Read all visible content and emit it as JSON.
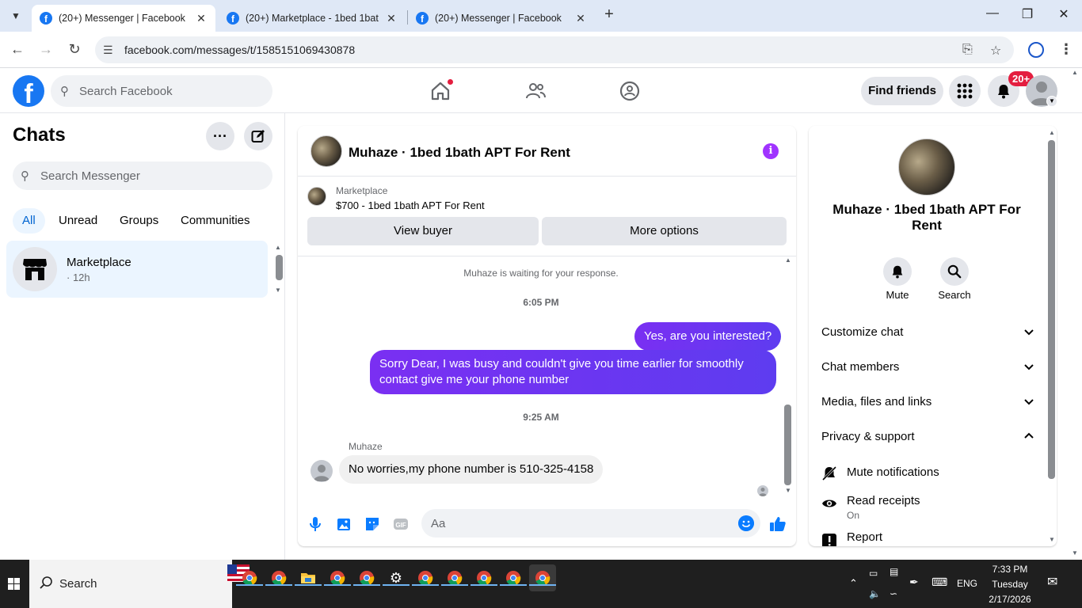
{
  "browser": {
    "tabs": [
      {
        "title": "(20+) Messenger | Facebook",
        "active": true
      },
      {
        "title": "(20+) Marketplace - 1bed 1bat",
        "active": false
      },
      {
        "title": "(20+) Messenger | Facebook",
        "active": false
      }
    ],
    "url": "facebook.com/messages/t/1585151069430878"
  },
  "fb_header": {
    "search_placeholder": "Search Facebook",
    "find_friends": "Find friends",
    "notif_count": "20+"
  },
  "chats": {
    "title": "Chats",
    "search_placeholder": "Search Messenger",
    "filters": [
      "All",
      "Unread",
      "Groups",
      "Communities"
    ],
    "items": [
      {
        "name": "Marketplace",
        "time": "· 12h"
      }
    ]
  },
  "conversation": {
    "name": "Muhaze · 1bed 1bath APT For Rent",
    "marketplace_label": "Marketplace",
    "listing": "$700 - 1bed 1bath APT For Rent",
    "view_buyer": "View buyer",
    "more_options": "More options",
    "waiting_notice": "Muhaze is waiting for your response.",
    "timestamp1": "6:05 PM",
    "msg_out1": "Yes, are you interested?",
    "msg_out2": "Sorry Dear, I was busy and couldn't give you time earlier for smoothly contact give me your phone number",
    "timestamp2": "9:25 AM",
    "sender": "Muhaze",
    "msg_in1": "No worries,my phone number is 510-325-4158",
    "composer_placeholder": "Aa",
    "composer_icons": [
      "microphone-icon",
      "photo-icon",
      "sticker-icon",
      "gif-icon",
      "emoji-icon",
      "like-icon"
    ]
  },
  "info_panel": {
    "name": "Muhaze · 1bed 1bath APT For Rent",
    "mute": "Mute",
    "search": "Search",
    "sections": [
      "Customize chat",
      "Chat members",
      "Media, files and links",
      "Privacy & support"
    ],
    "mute_notifications": "Mute notifications",
    "read_receipts": "Read receipts",
    "read_receipts_state": "On",
    "report": "Report"
  },
  "taskbar": {
    "search": "Search",
    "lang": "ENG",
    "time": "7:33 PM",
    "day": "Tuesday",
    "date": "2/17/2026"
  },
  "colors": {
    "fb_blue": "#1877f2",
    "messenger_purple": "#7a2ff2",
    "info_purple": "#a033ff",
    "badge_red": "#e41e3f"
  }
}
